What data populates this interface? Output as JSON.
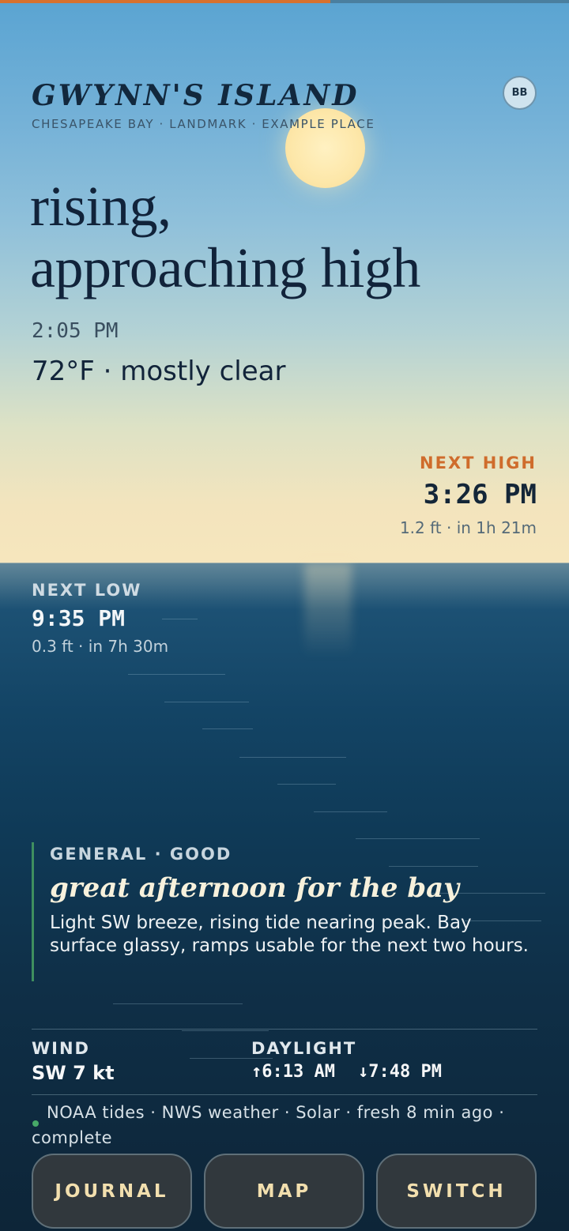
{
  "progress": {
    "fraction": 0.58
  },
  "header": {
    "title": "GWYNN'S ISLAND",
    "subtitle": "CHESAPEAKE BAY · LANDMARK · EXAMPLE PLACE",
    "avatar_initials": "BB"
  },
  "tide": {
    "headline_line1": "rising,",
    "headline_line2": "approaching high",
    "current_time": "2:05 PM",
    "weather": "72°F · mostly clear"
  },
  "next_high": {
    "label": "NEXT HIGH",
    "time": "3:26 PM",
    "detail": "1.2 ft · in 1h 21m"
  },
  "next_low": {
    "label": "NEXT LOW",
    "time": "9:35 PM",
    "detail": "0.3 ft · in 7h 30m"
  },
  "report": {
    "category": "GENERAL · GOOD",
    "title": "great afternoon for the bay",
    "body": "Light SW breeze, rising tide nearing peak. Bay surface glassy, ramps usable for the next two hours."
  },
  "stats": {
    "wind_label": "WIND",
    "wind_value": "SW 7 kt",
    "daylight_label": "DAYLIGHT",
    "sunrise": "↑6:13 AM",
    "sunset": "↓7:48 PM"
  },
  "status": {
    "text": "NOAA tides · NWS weather · Solar · fresh 8 min ago · complete"
  },
  "actions": {
    "journal": "JOURNAL",
    "map": "MAP",
    "switch": "SWITCH"
  },
  "colors": {
    "accent_orange": "#cf6c2c",
    "status_green": "#47a968",
    "button_text": "#f2dfae"
  }
}
